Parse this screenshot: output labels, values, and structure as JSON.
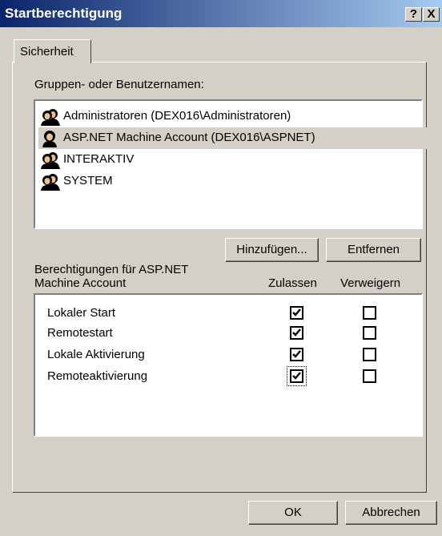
{
  "window": {
    "title": "Startberechtigung",
    "help_button": "?",
    "close_button": "X"
  },
  "tab": {
    "label": "Sicherheit"
  },
  "groups": {
    "label": "Gruppen- oder Benutzernamen:",
    "items": [
      {
        "name": "Administratoren (DEX016\\Administratoren)",
        "icon": "users-group-icon",
        "selected": false
      },
      {
        "name": "ASP.NET Machine Account (DEX016\\ASPNET)",
        "icon": "user-icon",
        "selected": true
      },
      {
        "name": "INTERAKTIV",
        "icon": "users-group-icon",
        "selected": false
      },
      {
        "name": "SYSTEM",
        "icon": "users-group-icon",
        "selected": false
      }
    ]
  },
  "buttons": {
    "add": "Hinzufügen...",
    "remove": "Entfernen",
    "ok": "OK",
    "cancel": "Abbrechen"
  },
  "permissions": {
    "label_line1": "Berechtigungen für ASP.NET",
    "label_line2": "Machine Account",
    "allow_header": "Zulassen",
    "deny_header": "Verweigern",
    "rows": [
      {
        "name": "Lokaler Start",
        "allow": true,
        "deny": false
      },
      {
        "name": "Remotestart",
        "allow": true,
        "deny": false
      },
      {
        "name": "Lokale Aktivierung",
        "allow": true,
        "deny": false
      },
      {
        "name": "Remoteaktivierung",
        "allow": true,
        "deny": false
      }
    ]
  },
  "colors": {
    "titlebar_start": "#0a246a",
    "titlebar_end": "#a6caf0",
    "face": "#d4d0c8"
  }
}
